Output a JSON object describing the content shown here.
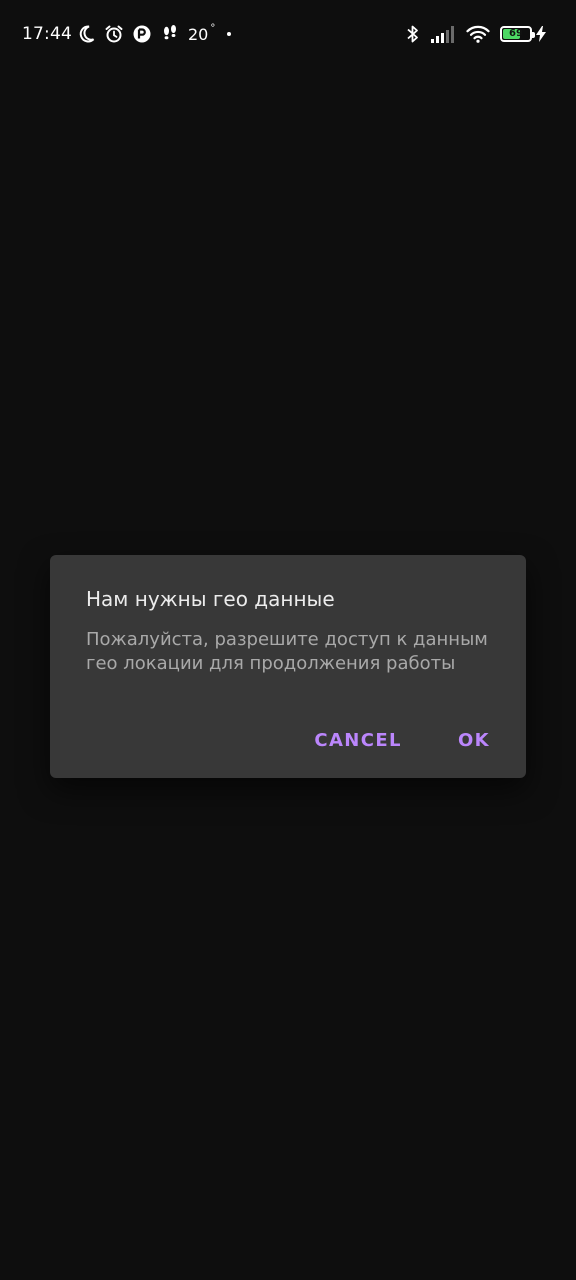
{
  "status_bar": {
    "time": "17:44",
    "temperature": "20",
    "degree_symbol": "°",
    "battery_level": 69,
    "battery_label": "69",
    "left_icons": [
      "moon-icon",
      "alarm-icon",
      "app-notification-icon",
      "steps-icon"
    ],
    "right_icons": [
      "bluetooth-icon",
      "signal-icon",
      "wifi-icon",
      "battery-icon",
      "charging-icon"
    ],
    "battery_color": "#4cd964"
  },
  "dialog": {
    "title": "Нам нужны гео данные",
    "message": "Пожалуйста, разрешите доступ к данным гео локации для продолжения работы",
    "cancel_label": "CANCEL",
    "ok_label": "OK",
    "accent_color": "#bb86fc"
  }
}
